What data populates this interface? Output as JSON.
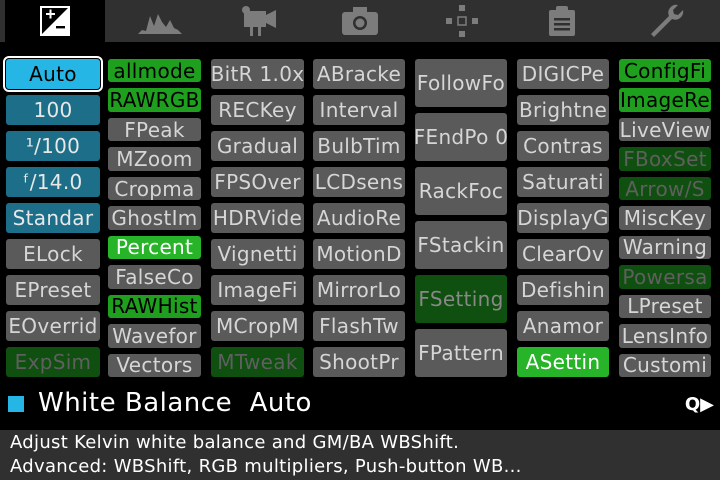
{
  "tabs": [
    {
      "name": "exposure-icon",
      "active": true
    },
    {
      "name": "histogram-icon",
      "active": false
    },
    {
      "name": "movie-camera-icon",
      "active": false
    },
    {
      "name": "camera-icon",
      "active": false
    },
    {
      "name": "focus-icon",
      "active": false
    },
    {
      "name": "clipboard-icon",
      "active": false
    },
    {
      "name": "wrench-icon",
      "active": false
    }
  ],
  "columns": [
    [
      {
        "label": "Auto",
        "style": "selected"
      },
      {
        "label": "100",
        "style": "blue"
      },
      {
        "label": "¹/100",
        "style": "blue"
      },
      {
        "label": "ᶠ/14.0",
        "style": "blue"
      },
      {
        "label": "Standar",
        "style": "blue"
      },
      {
        "label": "ELock",
        "style": "gray"
      },
      {
        "label": "EPreset",
        "style": "gray"
      },
      {
        "label": "EOverrid",
        "style": "gray"
      },
      {
        "label": "ExpSim",
        "style": "dgreen"
      }
    ],
    [
      {
        "label": "allmode",
        "style": "green"
      },
      {
        "label": "RAWRGB",
        "style": "green"
      },
      {
        "label": "FPeak",
        "style": "gray"
      },
      {
        "label": "MZoom",
        "style": "gray"
      },
      {
        "label": "Cropma",
        "style": "gray"
      },
      {
        "label": "GhostIm",
        "style": "gray"
      },
      {
        "label": "Percent",
        "style": "green-bright"
      },
      {
        "label": "FalseCo",
        "style": "gray"
      },
      {
        "label": "RAWHist",
        "style": "green"
      },
      {
        "label": "Wavefor",
        "style": "gray"
      },
      {
        "label": "Vectors",
        "style": "gray"
      }
    ],
    [
      {
        "label": "BitR 1.0x",
        "style": "gray"
      },
      {
        "label": "RECKey",
        "style": "gray"
      },
      {
        "label": "Gradual",
        "style": "gray"
      },
      {
        "label": "FPSOver",
        "style": "gray"
      },
      {
        "label": "HDRVide",
        "style": "gray"
      },
      {
        "label": "Vignetti",
        "style": "gray"
      },
      {
        "label": "ImageFi",
        "style": "gray"
      },
      {
        "label": "MCropM",
        "style": "gray"
      },
      {
        "label": "MTweak",
        "style": "dgreen"
      }
    ],
    [
      {
        "label": "ABracke",
        "style": "gray"
      },
      {
        "label": "Interval",
        "style": "gray"
      },
      {
        "label": "BulbTim",
        "style": "gray"
      },
      {
        "label": "LCDsens",
        "style": "gray"
      },
      {
        "label": "AudioRe",
        "style": "gray"
      },
      {
        "label": "MotionD",
        "style": "gray"
      },
      {
        "label": "MirrorLo",
        "style": "gray"
      },
      {
        "label": "FlashTw",
        "style": "gray"
      },
      {
        "label": "ShootPr",
        "style": "gray"
      }
    ],
    [
      {
        "label": "FollowFo",
        "style": "gray"
      },
      {
        "label": "FEndPo 0",
        "style": "gray"
      },
      {
        "label": "RackFoc",
        "style": "gray"
      },
      {
        "label": "FStackin",
        "style": "gray"
      },
      {
        "label": "FSetting",
        "style": "dgreen2"
      },
      {
        "label": "FPattern",
        "style": "gray"
      }
    ],
    [
      {
        "label": "DIGICPe",
        "style": "gray"
      },
      {
        "label": "Brightne",
        "style": "gray"
      },
      {
        "label": "Contras",
        "style": "gray"
      },
      {
        "label": "Saturati",
        "style": "gray"
      },
      {
        "label": "DisplayG",
        "style": "gray"
      },
      {
        "label": "ClearOv",
        "style": "gray"
      },
      {
        "label": "Defishin",
        "style": "gray"
      },
      {
        "label": "Anamor",
        "style": "gray"
      },
      {
        "label": "ASettin",
        "style": "green-bright"
      }
    ],
    [
      {
        "label": "ConfigFi",
        "style": "green"
      },
      {
        "label": "ImageRe",
        "style": "green"
      },
      {
        "label": "LiveView",
        "style": "gray"
      },
      {
        "label": "FBoxSet",
        "style": "dgreen"
      },
      {
        "label": "Arrow/S",
        "style": "dgreen"
      },
      {
        "label": "MiscKey",
        "style": "gray"
      },
      {
        "label": "Warning",
        "style": "gray"
      },
      {
        "label": "Powersa",
        "style": "dgreen"
      },
      {
        "label": "LPreset",
        "style": "gray"
      },
      {
        "label": "LensInfo",
        "style": "gray"
      },
      {
        "label": "Customi",
        "style": "gray"
      }
    ]
  ],
  "status": {
    "title": "White Balance",
    "value": "Auto",
    "swatch_color": "#25b6e6",
    "q_hint": "Q▶"
  },
  "help": {
    "line1": "Adjust Kelvin white balance and GM/BA WBShift.",
    "line2": "Advanced: WBShift, RGB multipliers, Push-button WB..."
  }
}
